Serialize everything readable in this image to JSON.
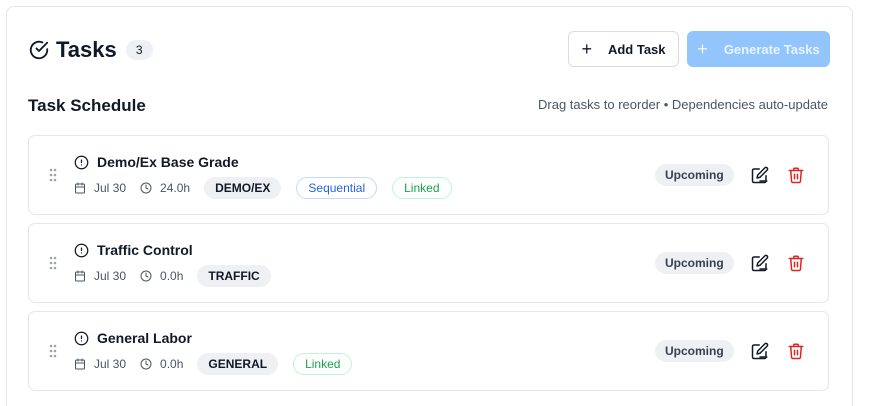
{
  "header": {
    "title": "Tasks",
    "count": "3",
    "add_label": "Add Task",
    "generate_label": "Generate Tasks"
  },
  "section": {
    "title": "Task Schedule",
    "hint": "Drag tasks to reorder • Dependencies auto-update"
  },
  "tasks": [
    {
      "title": "Demo/Ex Base Grade",
      "date": "Jul 30",
      "hours": "24.0h",
      "category": "DEMO/EX",
      "tags": [
        "Sequential",
        "Linked"
      ],
      "status": "Upcoming"
    },
    {
      "title": "Traffic Control",
      "date": "Jul 30",
      "hours": "0.0h",
      "category": "TRAFFIC",
      "tags": [],
      "status": "Upcoming"
    },
    {
      "title": "General Labor",
      "date": "Jul 30",
      "hours": "0.0h",
      "category": "GENERAL",
      "tags": [
        "Linked"
      ],
      "status": "Upcoming"
    }
  ],
  "icons": {
    "title": "circle-check-icon",
    "task": "alert-circle-icon",
    "date": "calendar-icon",
    "hours": "clock-icon",
    "drag": "grip-vertical-icon",
    "edit": "edit-icon",
    "delete": "trash-icon"
  },
  "colors": {
    "primary_disabled": "#93c5fd",
    "delete": "#dc2626",
    "sequential": "#2563eb",
    "linked": "#16a34a"
  }
}
